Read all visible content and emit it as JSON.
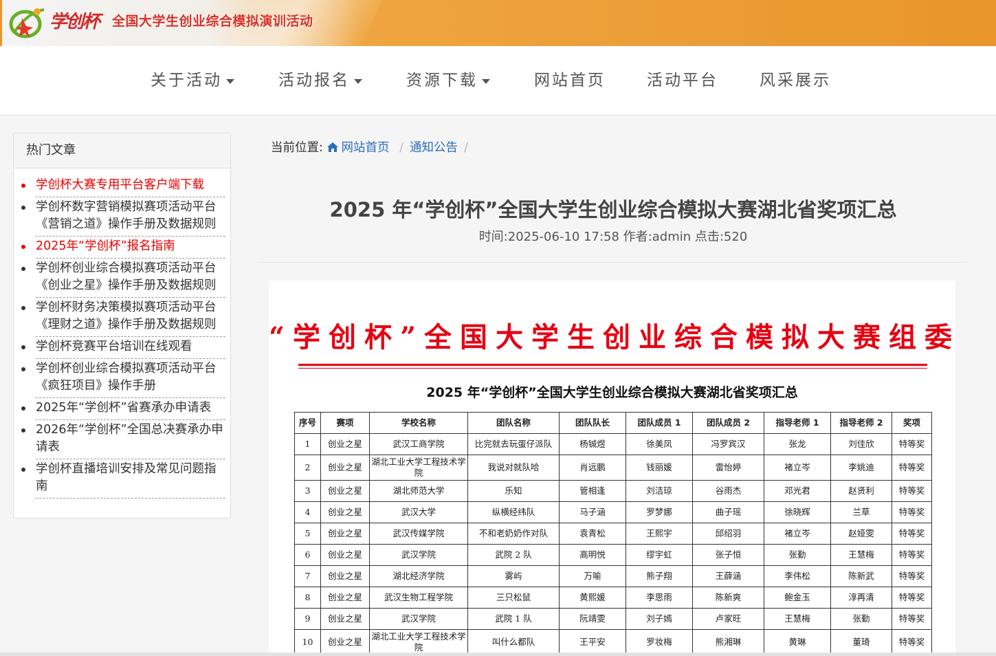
{
  "header": {
    "brand_script": "学创杯",
    "title": "全国大学生创业综合模拟演训活动"
  },
  "nav": {
    "items": [
      {
        "label": "关于活动",
        "dropdown": true
      },
      {
        "label": "活动报名",
        "dropdown": true
      },
      {
        "label": "资源下载",
        "dropdown": true
      },
      {
        "label": "网站首页",
        "dropdown": false
      },
      {
        "label": "活动平台",
        "dropdown": false
      },
      {
        "label": "风采展示",
        "dropdown": false
      }
    ]
  },
  "sidebar": {
    "title": "热门文章",
    "items": [
      {
        "label": "学创杯大赛专用平台客户端下载",
        "hot": true
      },
      {
        "label": "学创杯数字营销模拟赛项活动平台《营销之道》操作手册及数据规则",
        "hot": false
      },
      {
        "label": "2025年“学创杯”报名指南",
        "hot": true
      },
      {
        "label": "学创杯创业综合模拟赛项活动平台《创业之星》操作手册及数据规则",
        "hot": false
      },
      {
        "label": "学创杯财务决策模拟赛项活动平台《理财之道》操作手册及数据规则",
        "hot": false
      },
      {
        "label": "学创杯竞赛平台培训在线观看",
        "hot": false
      },
      {
        "label": "学创杯创业综合模拟赛项活动平台《疯狂项目》操作手册",
        "hot": false
      },
      {
        "label": "2025年“学创杯”省赛承办申请表",
        "hot": false
      },
      {
        "label": "2026年“学创杯”全国总决赛承办申请表",
        "hot": false
      },
      {
        "label": "学创杯直播培训安排及常见问题指南",
        "hot": false
      }
    ]
  },
  "breadcrumb": {
    "prefix": "当前位置:",
    "home": "网站首页",
    "section": "通知公告",
    "sep": "/"
  },
  "article": {
    "title": "2025 年“学创杯”全国大学生创业综合模拟大赛湖北省奖项汇总",
    "meta": "时间:2025-06-10 17:58 作者:admin 点击:520"
  },
  "document": {
    "heading": "“学创杯”全国大学生创业综合模拟大赛组委会文件",
    "subtitle": "2025 年“学创杯”全国大学生创业综合模拟大赛湖北省奖项汇总",
    "columns": [
      "序号",
      "赛项",
      "学校名称",
      "团队名称",
      "团队队长",
      "团队成员 1",
      "团队成员 2",
      "指导老师 1",
      "指导老师 2",
      "奖项"
    ],
    "rows": [
      [
        "1",
        "创业之星",
        "武汉工商学院",
        "比完就去玩蛋仔派队",
        "杨铖煜",
        "徐美凤",
        "冯罗宾汉",
        "张龙",
        "刘佳欣",
        "特等奖"
      ],
      [
        "2",
        "创业之星",
        "湖北工业大学工程技术学院",
        "我说对就队哈",
        "肖远鹏",
        "钱丽媛",
        "雷怡婷",
        "褚立岑",
        "李姚迪",
        "特等奖"
      ],
      [
        "3",
        "创业之星",
        "湖北师范大学",
        "乐知",
        "管相逢",
        "刘洁琼",
        "谷雨杰",
        "邓光君",
        "赵贤利",
        "特等奖"
      ],
      [
        "4",
        "创业之星",
        "武汉大学",
        "纵横经纬队",
        "马子涵",
        "罗梦娜",
        "曲子瑶",
        "徐晓辉",
        "兰草",
        "特等奖"
      ],
      [
        "5",
        "创业之星",
        "武汉传媒学院",
        "不和老奶奶作对队",
        "袁青松",
        "王熙宇",
        "邱绍羽",
        "褚立岑",
        "赵娅雯",
        "特等奖"
      ],
      [
        "6",
        "创业之星",
        "武汉学院",
        "武院 2 队",
        "高明悦",
        "缪宇虹",
        "张子恒",
        "张勤",
        "王慧梅",
        "特等奖"
      ],
      [
        "7",
        "创业之星",
        "湖北经济学院",
        "雾屿",
        "万喻",
        "熊子翔",
        "王薛涵",
        "李伟松",
        "陈新武",
        "特等奖"
      ],
      [
        "8",
        "创业之星",
        "武汉生物工程学院",
        "三只松鼠",
        "黄熙媛",
        "李思雨",
        "陈新爽",
        "鲍金玉",
        "淳再清",
        "特等奖"
      ],
      [
        "9",
        "创业之星",
        "武汉学院",
        "武院 1 队",
        "阮靖雯",
        "刘子嫣",
        "卢家旺",
        "王慧梅",
        "张勤",
        "特等奖"
      ],
      [
        "10",
        "创业之星",
        "湖北工业大学工程技术学院",
        "叫什么都队",
        "王平安",
        "罗妆梅",
        "熊湘琳",
        "黄琳",
        "董琦",
        "特等奖"
      ]
    ]
  }
}
